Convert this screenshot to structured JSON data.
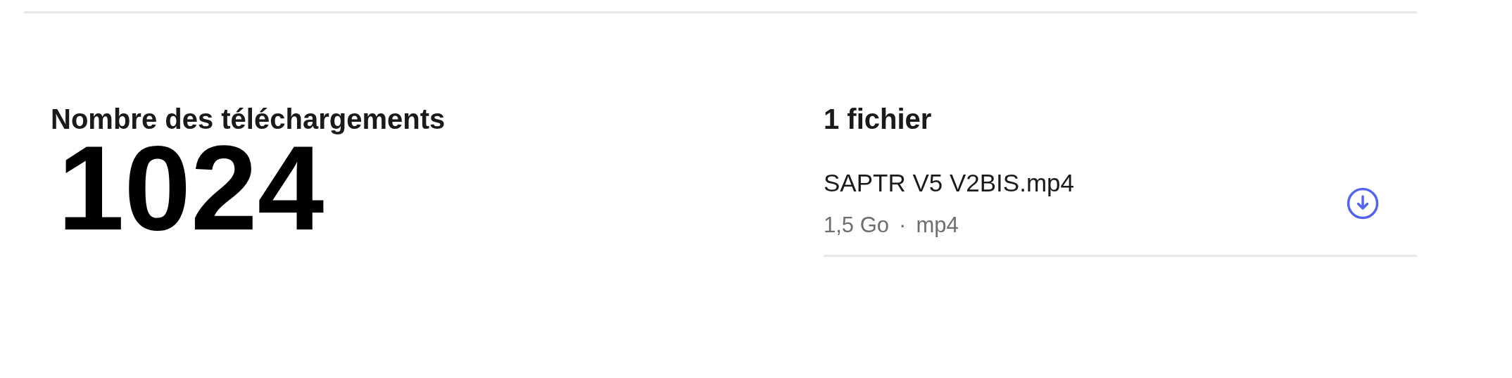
{
  "downloads": {
    "label": "Nombre des téléchargements",
    "count": "1024"
  },
  "files": {
    "heading": "1 fichier",
    "items": [
      {
        "name": "SAPTR V5 V2BIS.mp4",
        "size": "1,5 Go",
        "separator": "·",
        "type": "mp4"
      }
    ]
  }
}
